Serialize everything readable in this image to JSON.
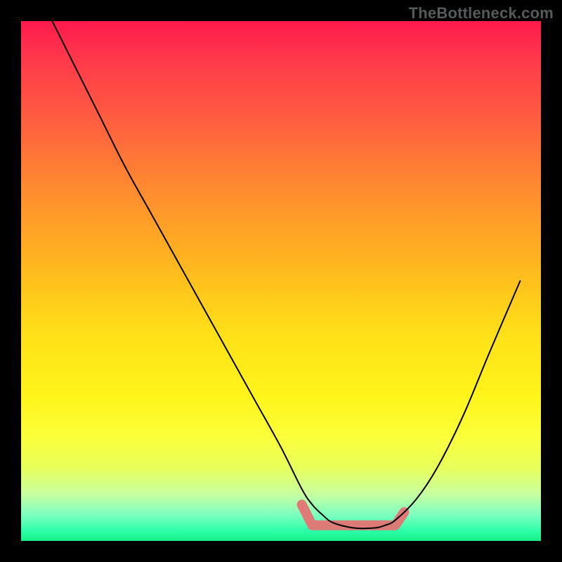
{
  "brand": "TheBottleneck.com",
  "chart_data": {
    "type": "line",
    "title": "",
    "xlabel": "",
    "ylabel": "",
    "xlim": [
      0,
      100
    ],
    "ylim": [
      0,
      100
    ],
    "grid": false,
    "series": [
      {
        "name": "curve",
        "x": [
          6,
          10,
          15,
          20,
          25,
          30,
          35,
          40,
          45,
          50,
          54,
          56,
          58,
          60,
          64,
          68,
          70,
          72,
          76,
          80,
          85,
          90,
          96
        ],
        "values": [
          100,
          92,
          82,
          72,
          63,
          54,
          45,
          36,
          27,
          18,
          10,
          7,
          5,
          3.5,
          2.5,
          2.5,
          3,
          4,
          8,
          14,
          24,
          36,
          50
        ]
      }
    ],
    "highlight": {
      "name": "flat-region",
      "x_start": 56,
      "x_end": 72,
      "y": 3
    },
    "gradient_stops": [
      {
        "pos": 0,
        "color": "#ff1a4d"
      },
      {
        "pos": 50,
        "color": "#ffd020"
      },
      {
        "pos": 85,
        "color": "#f4ff40"
      },
      {
        "pos": 100,
        "color": "#16f08a"
      }
    ]
  }
}
